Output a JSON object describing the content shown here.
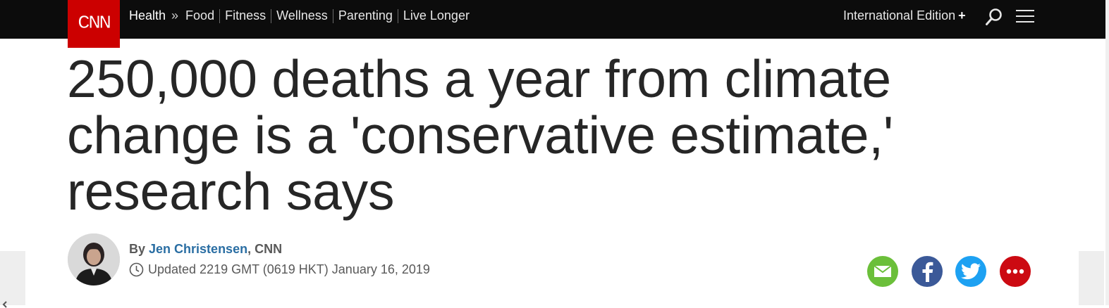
{
  "header": {
    "logo_text": "CNN",
    "logo_color": "#cc0000",
    "section": "Health",
    "separator": "»",
    "subnav": [
      "Food",
      "Fitness",
      "Wellness",
      "Parenting",
      "Live Longer"
    ],
    "edition": "International Edition",
    "edition_plus": "+",
    "search_icon": "search-icon",
    "menu_icon": "hamburger-menu-icon"
  },
  "article": {
    "headline": "250,000 deaths a year from climate change is a 'conservative estimate,' research says",
    "byline_prefix": "By",
    "author": "Jen Christensen",
    "outlet": ", CNN",
    "updated": "Updated 2219 GMT (0619 HKT) January 16, 2019"
  },
  "share": {
    "email_icon": "email-icon",
    "facebook_icon": "facebook-icon",
    "twitter_icon": "twitter-icon",
    "more_icon": "more-icon",
    "colors": {
      "email": "#6bbf3a",
      "facebook": "#3b5998",
      "twitter": "#1da1f2",
      "more": "#cc0a12"
    }
  }
}
